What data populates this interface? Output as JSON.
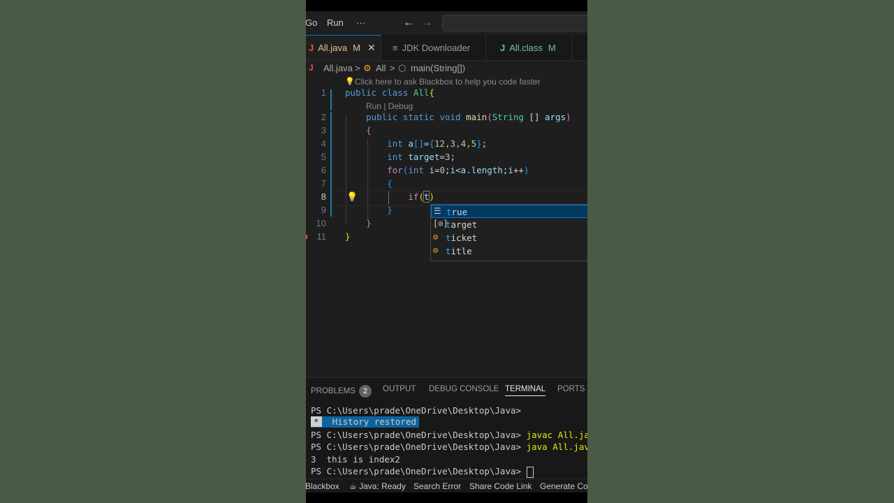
{
  "menu": {
    "go": "Go",
    "run": "Run",
    "more": "···",
    "back": "←",
    "forward": "→"
  },
  "tabs": [
    {
      "icon": "J",
      "label": "All.java",
      "badge": "M",
      "close": "✕"
    },
    {
      "icon": "≡",
      "label": "JDK Downloader"
    },
    {
      "icon": "J",
      "label": "All.class",
      "badge": "M"
    }
  ],
  "breadcrumb": {
    "file": "All.java",
    "sep": ">",
    "class": "All",
    "method": "main(String[])"
  },
  "editor": {
    "hint": "Click here to ask Blackbox to help you code faster",
    "codelens": "Run | Debug",
    "line_numbers": [
      "1",
      "2",
      "3",
      "4",
      "5",
      "6",
      "7",
      "8",
      "9",
      "10",
      "11"
    ],
    "code": {
      "l1_public": "public",
      "l1_class": "class",
      "l1_name": "All",
      "l2_mods": "public static void",
      "l2_fn": "main",
      "l2_type": "String",
      "l2_arr": " [] ",
      "l2_arg": "args",
      "l4_int": "int",
      "l4_var": "a",
      "l4_nums": "12,3,4,5",
      "l5_int": "int",
      "l5_var": "target",
      "l5_num": "3",
      "l6_for": "for",
      "l6_int": "int",
      "l6_i": "i",
      "l6_zero": "0",
      "l6_a": "a",
      "l6_len": "length",
      "l8_if": "if",
      "l8_t": "t"
    }
  },
  "suggestions": [
    {
      "icon": "keyword-icon",
      "label": "true",
      "match": "t",
      "rest": "rue"
    },
    {
      "icon": "variable-icon",
      "label": "target",
      "match": "t",
      "rest": "arget"
    },
    {
      "icon": "class-icon",
      "label": "ticket",
      "match": "t",
      "rest": "icket"
    },
    {
      "icon": "class-icon",
      "label": "title",
      "match": "t",
      "rest": "itle"
    }
  ],
  "panel": {
    "tabs": [
      "PROBLEMS",
      "OUTPUT",
      "DEBUG CONSOLE",
      "TERMINAL",
      "PORTS"
    ],
    "problems_count": "2",
    "active_tab": "TERMINAL"
  },
  "terminal": {
    "prompt": "PS C:\\Users\\prade\\OneDrive\\Desktop\\Java>",
    "history": "History restored",
    "history_star": "*",
    "cmd1": "javac All.java",
    "cmd2": "java All.java",
    "output": "3  this is index2"
  },
  "statusbar": [
    "Blackbox",
    "Java: Ready",
    "Search Error",
    "Share Code Link",
    "Generate Code"
  ]
}
